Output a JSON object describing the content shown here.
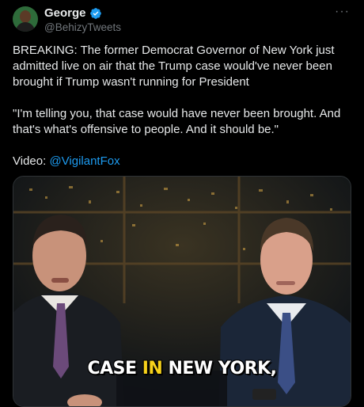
{
  "author": {
    "display_name": "George",
    "handle": "@BehizyTweets",
    "verified": true
  },
  "menu_icon": "more-horizontal-icon",
  "tweet": {
    "paragraph1": "BREAKING: The former Democrat Governor of New York just admitted live on air that the Trump case would've never been brought if Trump wasn't running for President",
    "paragraph2": "\"I'm telling you, that case would have never been brought. And that's what's offensive to people. And it should be.\"",
    "video_label": "Video: ",
    "video_link": "@VigilantFox"
  },
  "video": {
    "caption_before": "CASE ",
    "caption_highlight": "IN",
    "caption_after": " NEW YORK,"
  },
  "colors": {
    "background": "#000000",
    "text": "#e7e9ea",
    "secondary": "#71767b",
    "link": "#1d9bf0",
    "verified": "#1d9bf0",
    "caption_highlight": "#f7d21b"
  }
}
